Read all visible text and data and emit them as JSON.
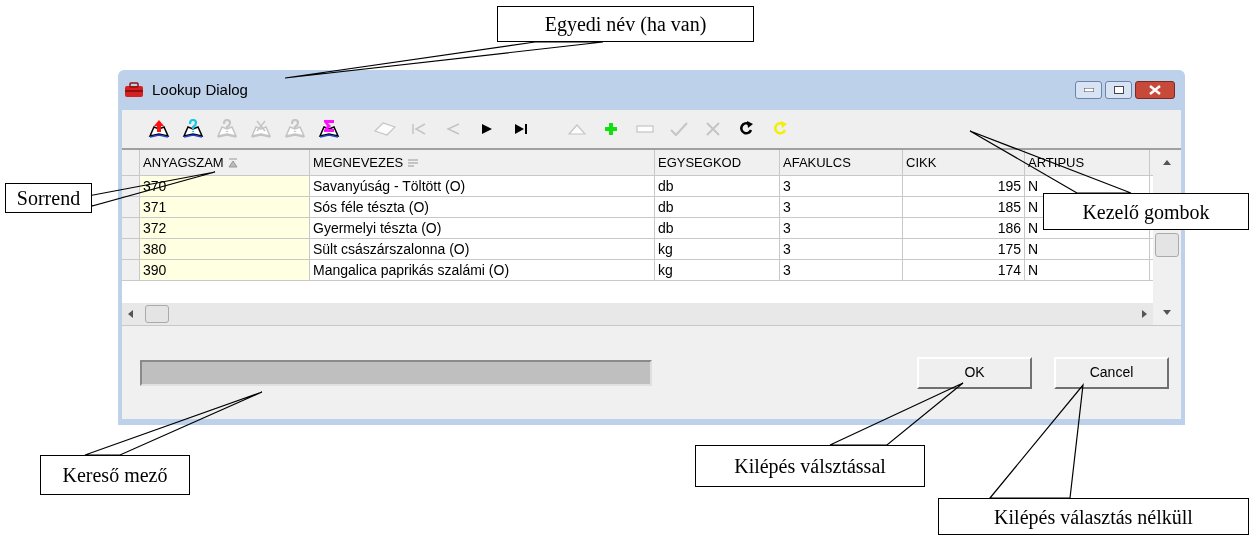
{
  "window": {
    "title": "Lookup Dialog"
  },
  "toolbar": {
    "buttons": [
      {
        "kind": "book-up",
        "disabled": false
      },
      {
        "kind": "book-query",
        "disabled": false
      },
      {
        "kind": "book-query",
        "disabled": true
      },
      {
        "kind": "book-cross",
        "disabled": true
      },
      {
        "kind": "book-query",
        "disabled": true
      },
      {
        "kind": "book-sum",
        "disabled": false
      },
      {
        "kind": "eraser",
        "disabled": true
      },
      {
        "kind": "first",
        "disabled": true
      },
      {
        "kind": "prior",
        "disabled": true
      },
      {
        "kind": "next",
        "disabled": false
      },
      {
        "kind": "last",
        "disabled": false
      },
      {
        "kind": "edit",
        "disabled": true
      },
      {
        "kind": "insert",
        "disabled": false
      },
      {
        "kind": "delete",
        "disabled": true
      },
      {
        "kind": "post",
        "disabled": true
      },
      {
        "kind": "cancel",
        "disabled": true
      },
      {
        "kind": "refresh",
        "disabled": false
      },
      {
        "kind": "refresh-alt",
        "disabled": false
      }
    ]
  },
  "table": {
    "columns": [
      {
        "label": "ANYAGSZAM",
        "kind": "sorted"
      },
      {
        "label": "MEGNEVEZES",
        "kind": "sortable"
      },
      {
        "label": "EGYSEGKOD",
        "kind": "text"
      },
      {
        "label": "AFAKULCS",
        "kind": "text"
      },
      {
        "label": "CIKK",
        "kind": "number"
      },
      {
        "label": "ARTIPUS",
        "kind": "text"
      }
    ],
    "rows": [
      [
        "370",
        "Savanyúság - Töltött (O)",
        "db",
        "3",
        "195",
        "N"
      ],
      [
        "371",
        "Sós féle tészta (O)",
        "db",
        "3",
        "185",
        "N"
      ],
      [
        "372",
        "Gyermelyi tészta (O)",
        "db",
        "3",
        "186",
        "N"
      ],
      [
        "380",
        "Sült császárszalonna (O)",
        "kg",
        "3",
        "175",
        "N"
      ],
      [
        "390",
        "Mangalica paprikás szalámi (O)",
        "kg",
        "3",
        "174",
        "N"
      ]
    ]
  },
  "buttons": [
    "OK",
    "Cancel"
  ],
  "callouts": [
    {
      "text": "Egyedi név (ha van)"
    },
    {
      "text": "Sorrend"
    },
    {
      "text": "Kezelő gombok"
    },
    {
      "text": "Kereső mező"
    },
    {
      "text": "Kilépés válsztással"
    },
    {
      "text": "Kilépés választás nélküll"
    }
  ]
}
